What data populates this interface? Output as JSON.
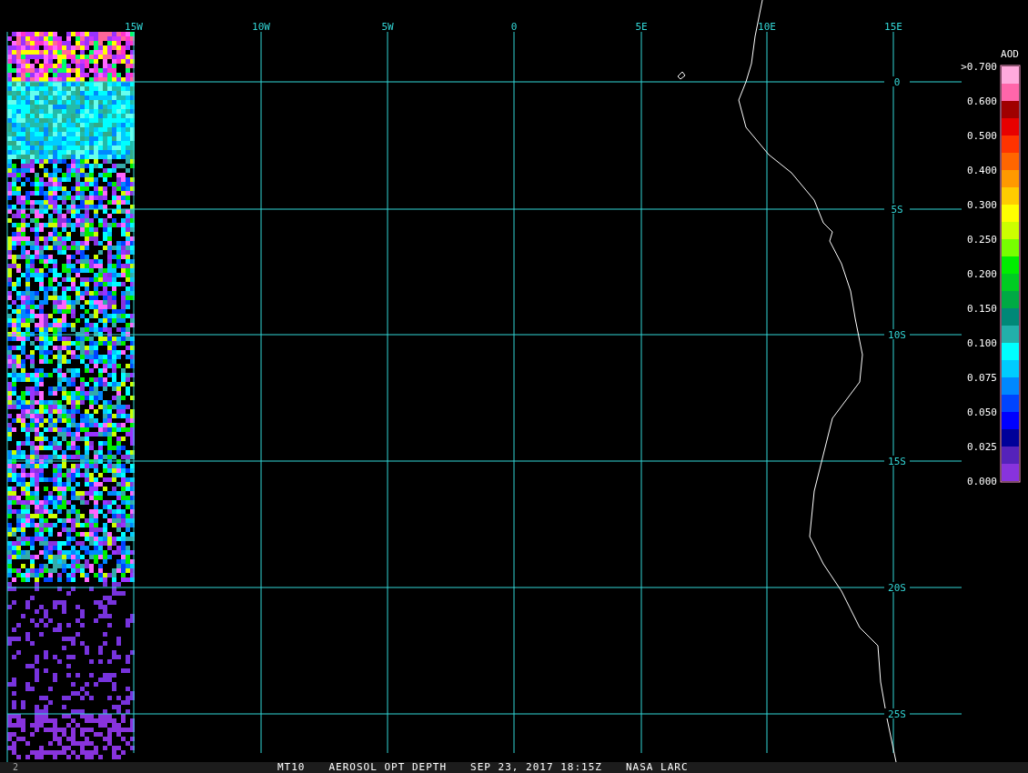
{
  "map": {
    "lon_labels": [
      "15W",
      "10W",
      "5W",
      "0",
      "5E",
      "10E",
      "15E"
    ],
    "lat_labels": [
      "0",
      "5S",
      "10S",
      "15S",
      "20S",
      "25S"
    ]
  },
  "legend": {
    "title": "AOD",
    "labels": [
      ">0.700",
      "0.600",
      "0.500",
      "0.400",
      "0.300",
      "0.250",
      "0.200",
      "0.150",
      "0.100",
      "0.075",
      "0.050",
      "0.025",
      "0.000"
    ],
    "swatches": [
      {
        "color": "#ffaadd"
      },
      {
        "color": "#ff66aa"
      },
      {
        "color": "#a00000"
      },
      {
        "color": "#e80000"
      },
      {
        "color": "#ff3300"
      },
      {
        "color": "#ff6600"
      },
      {
        "color": "#ff9900"
      },
      {
        "color": "#ffcc00"
      },
      {
        "color": "#ffff00"
      },
      {
        "color": "#ccff00"
      },
      {
        "color": "#77ff00"
      },
      {
        "color": "#00ee00"
      },
      {
        "color": "#00cc22"
      },
      {
        "color": "#00aa44"
      },
      {
        "color": "#008877"
      },
      {
        "color": "#22b0aa"
      },
      {
        "color": "#00ffff"
      },
      {
        "color": "#00ccff"
      },
      {
        "color": "#0088ff"
      },
      {
        "color": "#0044ff"
      },
      {
        "color": "#0000ff"
      },
      {
        "color": "#000099"
      },
      {
        "color": "#5522bb"
      },
      {
        "color": "#8833dd"
      }
    ]
  },
  "status_bar": {
    "frame": "2",
    "items": [
      "MT10",
      "AEROSOL OPT DEPTH",
      "SEP 23, 2017 18:15Z",
      "NASA LARC"
    ]
  }
}
